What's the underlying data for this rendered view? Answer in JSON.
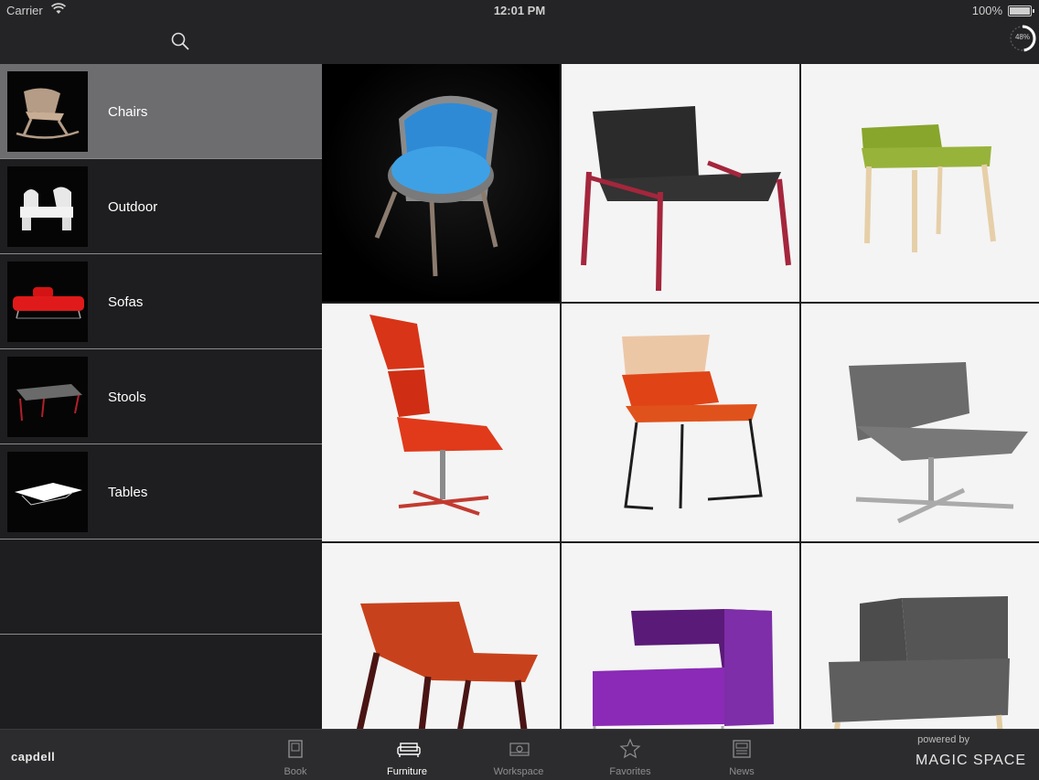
{
  "status_bar": {
    "carrier": "Carrier",
    "time": "12:01 PM",
    "battery": "100%"
  },
  "navbar": {
    "progress_text": "48%",
    "progress_value": 0.48
  },
  "sidebar": {
    "categories": [
      {
        "label": "Chairs",
        "selected": true
      },
      {
        "label": "Outdoor",
        "selected": false
      },
      {
        "label": "Sofas",
        "selected": false
      },
      {
        "label": "Stools",
        "selected": false
      },
      {
        "label": "Tables",
        "selected": false
      }
    ]
  },
  "products": [
    {
      "icon": "blue-chair-icon"
    },
    {
      "icon": "black-lounge-chair-icon"
    },
    {
      "icon": "green-chair-icon"
    },
    {
      "icon": "red-highback-chair-icon"
    },
    {
      "icon": "orange-sled-chair-icon"
    },
    {
      "icon": "grey-swivel-chair-icon"
    },
    {
      "icon": "leather-lounge-chair-icon"
    },
    {
      "icon": "purple-armchair-icon"
    },
    {
      "icon": "grey-armchair-icon"
    }
  ],
  "tabbar": {
    "brand": "capdell",
    "tabs": [
      {
        "label": "Book",
        "icon": "book-icon",
        "active": false
      },
      {
        "label": "Furniture",
        "icon": "sofa-icon",
        "active": true
      },
      {
        "label": "Workspace",
        "icon": "workspace-icon",
        "active": false
      },
      {
        "label": "Favorites",
        "icon": "star-icon",
        "active": false
      },
      {
        "label": "News",
        "icon": "news-icon",
        "active": false
      }
    ],
    "powered_by": "powered by",
    "partner": "MAGIC SPACE"
  },
  "colors": {
    "selected_row": "#6d6d70",
    "background": "#1e1e20",
    "tabbar": "#2c2c2e"
  }
}
